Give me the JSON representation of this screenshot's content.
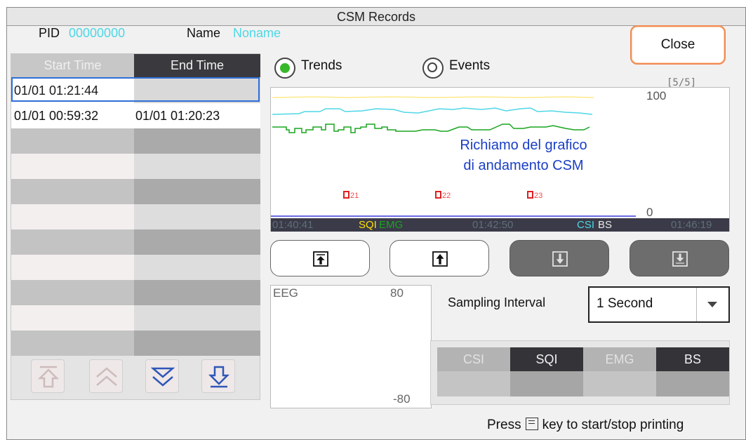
{
  "window": {
    "title": "CSM Records"
  },
  "patient": {
    "pid_label": "PID",
    "pid_value": "00000000",
    "name_label": "Name",
    "name_value": "Noname"
  },
  "close_label": "Close",
  "records": {
    "col_start": "Start Time",
    "col_end": "End Time",
    "rows": [
      {
        "start": "01/01 01:21:44",
        "end": ""
      },
      {
        "start": "01/01 00:59:32",
        "end": "01/01 01:20:23"
      }
    ]
  },
  "view_mode": {
    "trends_label": "Trends",
    "events_label": "Events",
    "selected": "Trends",
    "colors": {
      "selected": "#38b82a",
      "unselected": "#ffffff"
    }
  },
  "page_indicator": "[5/5]",
  "trend": {
    "max": "100",
    "min": "0",
    "annotation_line1": "Richiamo del grafico",
    "annotation_line2": "di andamento CSM",
    "time_start": "01:40:41",
    "time_mid": "01:42:50",
    "time_end": "01:46:19",
    "legend_sqi": "SQI",
    "legend_emg": "EMG",
    "legend_csi": "CSI",
    "legend_bs": "BS",
    "events": [
      "21",
      "22",
      "23"
    ],
    "colors": {
      "sqi": "#ffe200",
      "emg": "#19a51f",
      "csi": "#4ed7e6",
      "bs": "#d8d8d8"
    }
  },
  "eeg": {
    "label": "EEG",
    "max": "80",
    "min": "-80"
  },
  "sampling": {
    "label": "Sampling Interval",
    "value": "1 Second"
  },
  "params": {
    "headers": [
      "CSI",
      "SQI",
      "EMG",
      "BS"
    ],
    "values": [
      "",
      "",
      "",
      ""
    ]
  },
  "footer": {
    "prefix": "Press",
    "key_icon": "print-key-icon",
    "suffix": "key to start/stop printing"
  }
}
